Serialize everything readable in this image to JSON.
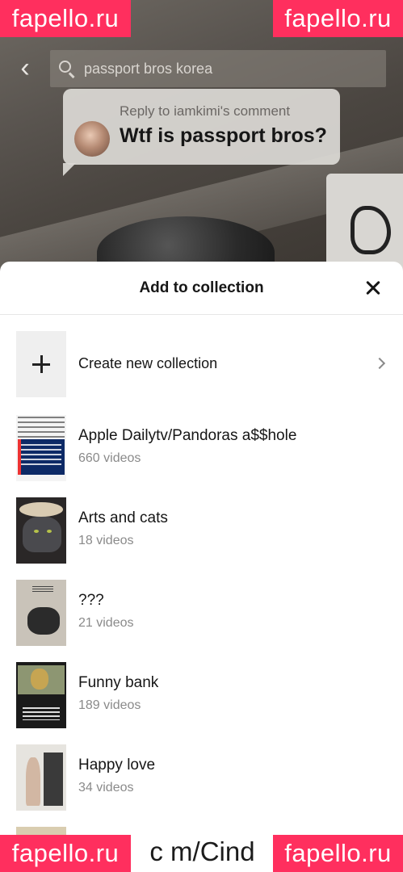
{
  "watermarks": {
    "site": "fapello.ru",
    "url_fragment": "c m/Cind"
  },
  "topbar": {
    "back_icon": "chevron-left-icon",
    "search_query": "passport bros korea",
    "search_icon": "search-icon"
  },
  "reply_bubble": {
    "reply_to": "Reply to iamkimi's comment",
    "text": "Wtf is passport bros?"
  },
  "sheet": {
    "title": "Add to collection",
    "close_icon": "close-icon",
    "create_label": "Create new collection",
    "collections": [
      {
        "name": "Apple Dailytv/Pandoras a$$hole",
        "count": "660 videos"
      },
      {
        "name": "Arts and cats",
        "count": "18 videos"
      },
      {
        "name": "???",
        "count": "21 videos"
      },
      {
        "name": "Funny bank",
        "count": "189 videos"
      },
      {
        "name": "Happy love",
        "count": "34 videos"
      }
    ]
  },
  "colors": {
    "watermark_bg": "#ff2f5e",
    "sheet_bg": "#ffffff",
    "text_primary": "#161616",
    "text_secondary": "#8a8a8a"
  }
}
